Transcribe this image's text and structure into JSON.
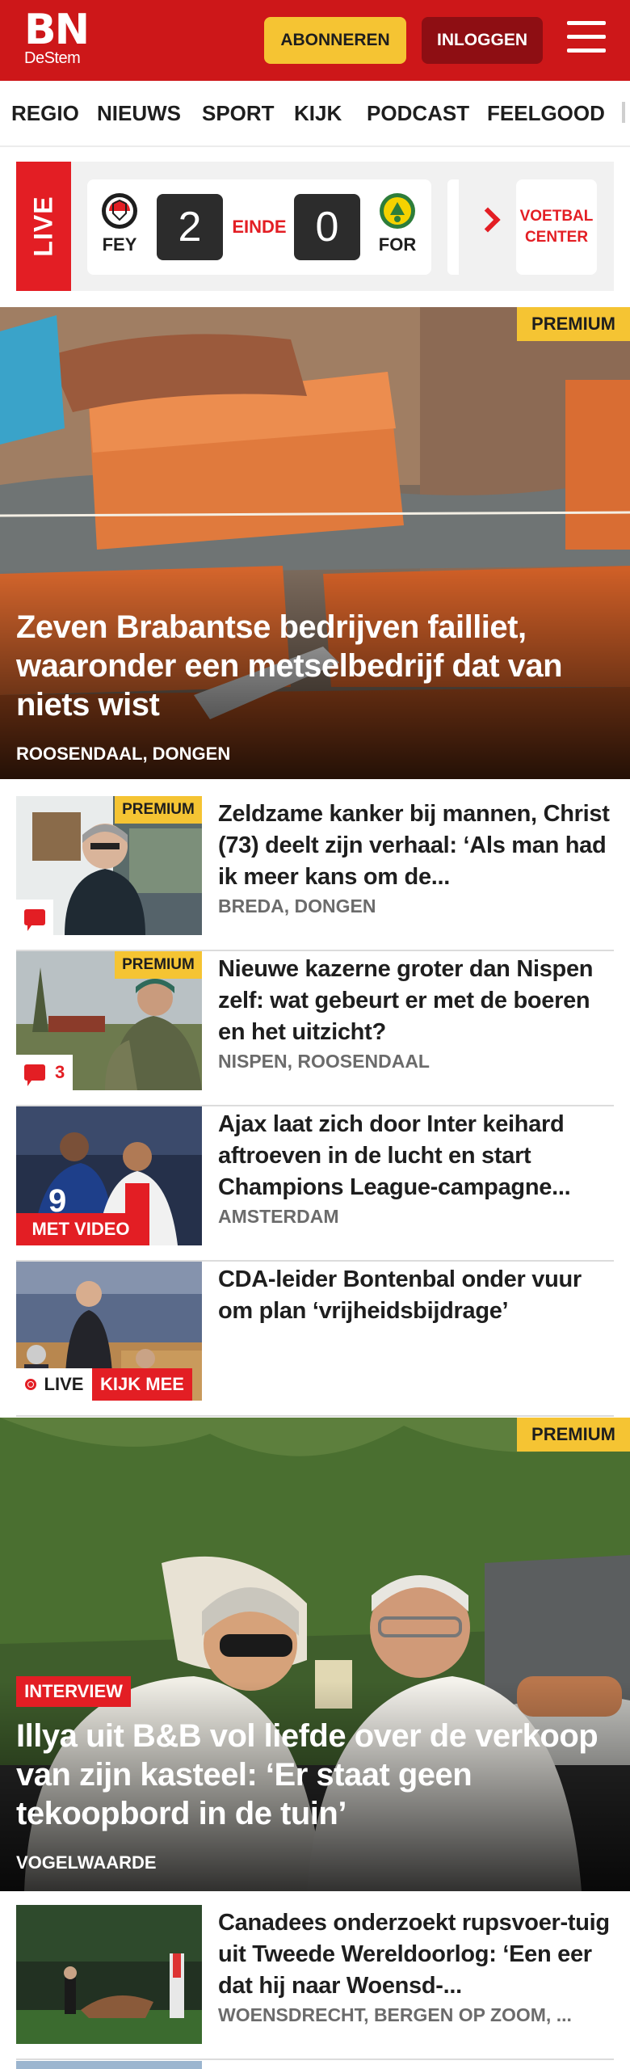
{
  "header": {
    "logo_main": "BN",
    "logo_sub": "DeStem",
    "subscribe_label": "ABONNEREN",
    "login_label": "INLOGGEN",
    "brand_color": "#cd1719"
  },
  "nav": {
    "items": [
      "REGIO",
      "NIEUWS",
      "SPORT",
      "KIJK",
      "PODCAST",
      "FEELGOOD"
    ]
  },
  "scores": {
    "live_label": "LIVE",
    "home_abbr": "FEY",
    "home_score": "2",
    "status": "EINDE",
    "away_score": "0",
    "away_abbr": "FOR",
    "center_label_1": "VOETBAL",
    "center_label_2": "CENTER"
  },
  "hero1": {
    "premium": "PREMIUM",
    "title": "Zeven Brabantse bedrijven failliet, waaronder een metselbedrijf dat van niets wist",
    "location": "ROOSENDAAL, DONGEN"
  },
  "articles": [
    {
      "premium": "PREMIUM",
      "title": "Zeldzame kanker bij mannen, Christ (73) deelt zijn verhaal: ‘Als man had ik meer kans om de...",
      "location": "BREDA, DONGEN"
    },
    {
      "premium": "PREMIUM",
      "title": "Nieuwe kazerne groter dan Nispen zelf: wat gebeurt er met de boeren en het uitzicht?",
      "location": "NISPEN, ROOSENDAAL",
      "comments": "3"
    },
    {
      "video_label": "MET VIDEO",
      "title": "Ajax laat zich door Inter keihard aftroeven in de lucht en start Champions League-campagne...",
      "location": "AMSTERDAM"
    },
    {
      "title": "CDA-leider Bontenbal onder vuur om plan ‘vrijheidsbijdrage’",
      "live_label": "LIVE",
      "watch_label": "KIJK MEE"
    }
  ],
  "hero2": {
    "premium": "PREMIUM",
    "tag": "INTERVIEW",
    "title": "Illya uit B&B vol liefde over de verkoop van zijn kasteel: ‘Er staat geen tekoopbord in de tuin’",
    "location": "VOGELWAARDE"
  },
  "article_last": {
    "title": "Canadees onderzoekt rupsvoer-tuig uit Tweede Wereldoorlog: ‘Een eer dat hij naar Woensd-...",
    "location": "WOENSDRECHT, BERGEN OP ZOOM, ..."
  }
}
